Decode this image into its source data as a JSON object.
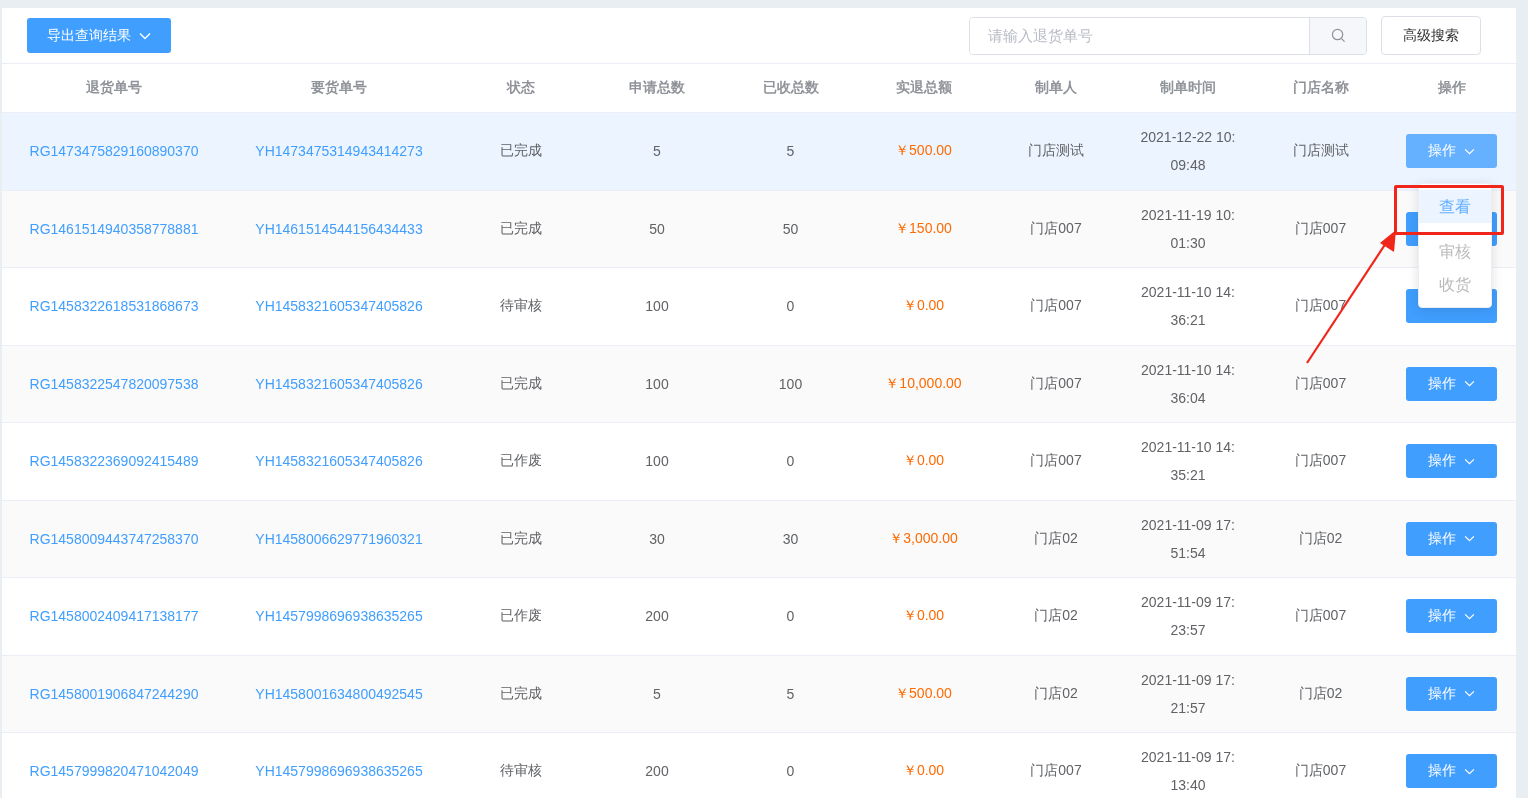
{
  "toolbar": {
    "export_button": "导出查询结果",
    "search": {
      "placeholder": "请输入退货单号"
    },
    "advanced_button": "高级搜索"
  },
  "table": {
    "columns": [
      "退货单号",
      "要货单号",
      "状态",
      "申请总数",
      "已收总数",
      "实退总额",
      "制单人",
      "制单时间",
      "门店名称",
      "操作"
    ],
    "rows": [
      {
        "return_no": "RG1473475829160890370",
        "order_no": "YH1473475314943414273",
        "status": "已完成",
        "applied": "5",
        "received": "5",
        "amount": "￥500.00",
        "creator": "门店测试",
        "time": [
          "2021-12-22 10:",
          "09:48"
        ],
        "store": "门店测试",
        "action": "操作",
        "hovered": true
      },
      {
        "return_no": "RG1461514940358778881",
        "order_no": "YH1461514544156434433",
        "status": "已完成",
        "applied": "50",
        "received": "50",
        "amount": "￥150.00",
        "creator": "门店007",
        "time": [
          "2021-11-19 10:",
          "01:30"
        ],
        "store": "门店007",
        "hovered": false
      },
      {
        "return_no": "RG1458322618531868673",
        "order_no": "YH1458321605347405826",
        "status": "待审核",
        "applied": "100",
        "received": "0",
        "amount": "￥0.00",
        "creator": "门店007",
        "time": [
          "2021-11-10 14:",
          "36:21"
        ],
        "store": "门店007",
        "hovered": false
      },
      {
        "return_no": "RG1458322547820097538",
        "order_no": "YH1458321605347405826",
        "status": "已完成",
        "applied": "100",
        "received": "100",
        "amount": "￥10,000.00",
        "creator": "门店007",
        "time": [
          "2021-11-10 14:",
          "36:04"
        ],
        "store": "门店007",
        "action": "操作",
        "hovered": false
      },
      {
        "return_no": "RG1458322369092415489",
        "order_no": "YH1458321605347405826",
        "status": "已作废",
        "applied": "100",
        "received": "0",
        "amount": "￥0.00",
        "creator": "门店007",
        "time": [
          "2021-11-10 14:",
          "35:21"
        ],
        "store": "门店007",
        "action": "操作",
        "hovered": false
      },
      {
        "return_no": "RG1458009443747258370",
        "order_no": "YH1458006629771960321",
        "status": "已完成",
        "applied": "30",
        "received": "30",
        "amount": "￥3,000.00",
        "creator": "门店02",
        "time": [
          "2021-11-09 17:",
          "51:54"
        ],
        "store": "门店02",
        "action": "操作",
        "hovered": false
      },
      {
        "return_no": "RG1458002409417138177",
        "order_no": "YH1457998696938635265",
        "status": "已作废",
        "applied": "200",
        "received": "0",
        "amount": "￥0.00",
        "creator": "门店02",
        "time": [
          "2021-11-09 17:",
          "23:57"
        ],
        "store": "门店007",
        "action": "操作",
        "hovered": false
      },
      {
        "return_no": "RG1458001906847244290",
        "order_no": "YH1458001634800492545",
        "status": "已完成",
        "applied": "5",
        "received": "5",
        "amount": "￥500.00",
        "creator": "门店02",
        "time": [
          "2021-11-09 17:",
          "21:57"
        ],
        "store": "门店02",
        "action": "操作",
        "hovered": false
      },
      {
        "return_no": "RG1457999820471042049",
        "order_no": "YH1457998696938635265",
        "status": "待审核",
        "applied": "200",
        "received": "0",
        "amount": "￥0.00",
        "creator": "门店007",
        "time": [
          "2021-11-09 17:",
          "13:40"
        ],
        "store": "门店007",
        "action": "操作",
        "hovered": false
      }
    ]
  },
  "dropdown_menu": {
    "items": [
      {
        "label": "查看",
        "hovered": true,
        "disabled": false
      },
      {
        "label": "审核",
        "hovered": false,
        "disabled": true
      },
      {
        "label": "收货",
        "hovered": false,
        "disabled": true
      }
    ]
  }
}
